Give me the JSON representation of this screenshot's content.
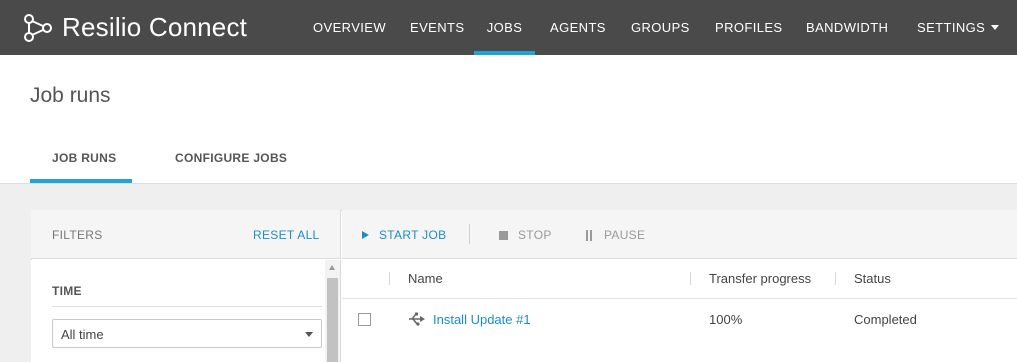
{
  "app": {
    "brand_name": "Resilio Connect",
    "logo_icon": "resilio-logo-icon"
  },
  "nav": {
    "items": [
      {
        "label": "OVERVIEW"
      },
      {
        "label": "EVENTS"
      },
      {
        "label": "JOBS",
        "active": true
      },
      {
        "label": "AGENTS"
      },
      {
        "label": "GROUPS"
      },
      {
        "label": "PROFILES"
      },
      {
        "label": "BANDWIDTH"
      },
      {
        "label": "SETTINGS",
        "has_dropdown": true
      }
    ]
  },
  "page": {
    "title": "Job runs",
    "tabs": [
      {
        "label": "JOB RUNS",
        "active": true
      },
      {
        "label": "CONFIGURE JOBS"
      }
    ]
  },
  "filters": {
    "header": "FILTERS",
    "reset_label": "RESET ALL",
    "time": {
      "label": "TIME",
      "selected": "All time"
    }
  },
  "toolbar": {
    "start_label": "START JOB",
    "stop_label": "STOP",
    "pause_label": "PAUSE",
    "start_icon": "play-icon",
    "stop_icon": "stop-icon",
    "pause_icon": "pause-icon"
  },
  "table": {
    "columns": [
      "Name",
      "Transfer progress",
      "Status"
    ],
    "rows": [
      {
        "name": "Install Update #1",
        "icon": "distribution-job-icon",
        "progress": "100%",
        "status": "Completed"
      }
    ]
  },
  "colors": {
    "topbar": "#4a4a4a",
    "accent": "#1fa3db",
    "link": "#1a8ec9"
  }
}
